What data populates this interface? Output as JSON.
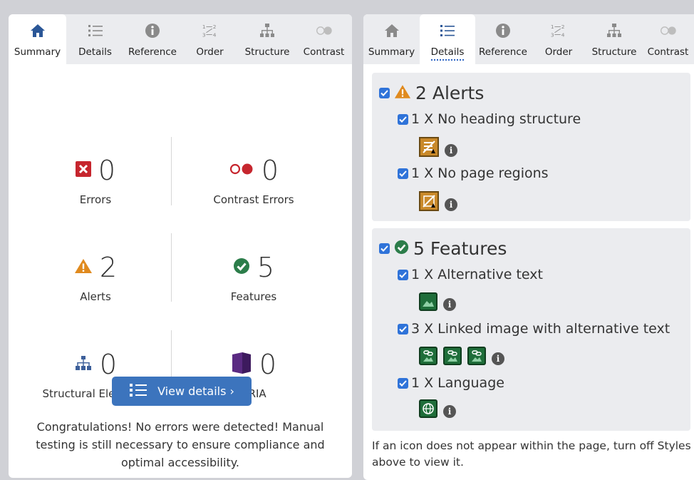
{
  "tabs": [
    {
      "label": "Summary",
      "icon": "home-icon"
    },
    {
      "label": "Details",
      "icon": "list-icon"
    },
    {
      "label": "Reference",
      "icon": "info-icon"
    },
    {
      "label": "Order",
      "icon": "order-icon"
    },
    {
      "label": "Structure",
      "icon": "structure-icon"
    },
    {
      "label": "Contrast",
      "icon": "contrast-icon"
    }
  ],
  "colors": {
    "error": "#c6262e",
    "alert": "#e08a1e",
    "feature": "#2c7d4a",
    "aria": "#5a2a82",
    "structure": "#3c5f9a",
    "accent": "#3c74bd"
  },
  "summary": {
    "errors": {
      "count": "0",
      "label": "Errors"
    },
    "contrast": {
      "count": "0",
      "label": "Contrast Errors"
    },
    "alerts": {
      "count": "2",
      "label": "Alerts"
    },
    "features": {
      "count": "5",
      "label": "Features"
    },
    "structural": {
      "count": "0",
      "label": "Structural Elements"
    },
    "aria": {
      "count": "0",
      "label": "ARIA"
    },
    "view_details": "View details ›",
    "congrats": "Congratulations! No errors were detected! Manual testing is still necessary to ensure compliance and optimal accessibility."
  },
  "details": {
    "alerts_heading": "2 Alerts",
    "alert_items": [
      {
        "label": "1 X No heading structure",
        "icon": "no-heading-icon"
      },
      {
        "label": "1 X No page regions",
        "icon": "no-regions-icon"
      }
    ],
    "features_heading": "5 Features",
    "feature_items": [
      {
        "label": "1 X Alternative text",
        "icon": "alt-text-icon"
      },
      {
        "label": "3 X Linked image with alternative text",
        "icon": "linked-image-icon"
      },
      {
        "label": "1 X Language",
        "icon": "language-icon"
      }
    ],
    "footnote": "If an icon does not appear within the page, turn off Styles above to view it."
  }
}
